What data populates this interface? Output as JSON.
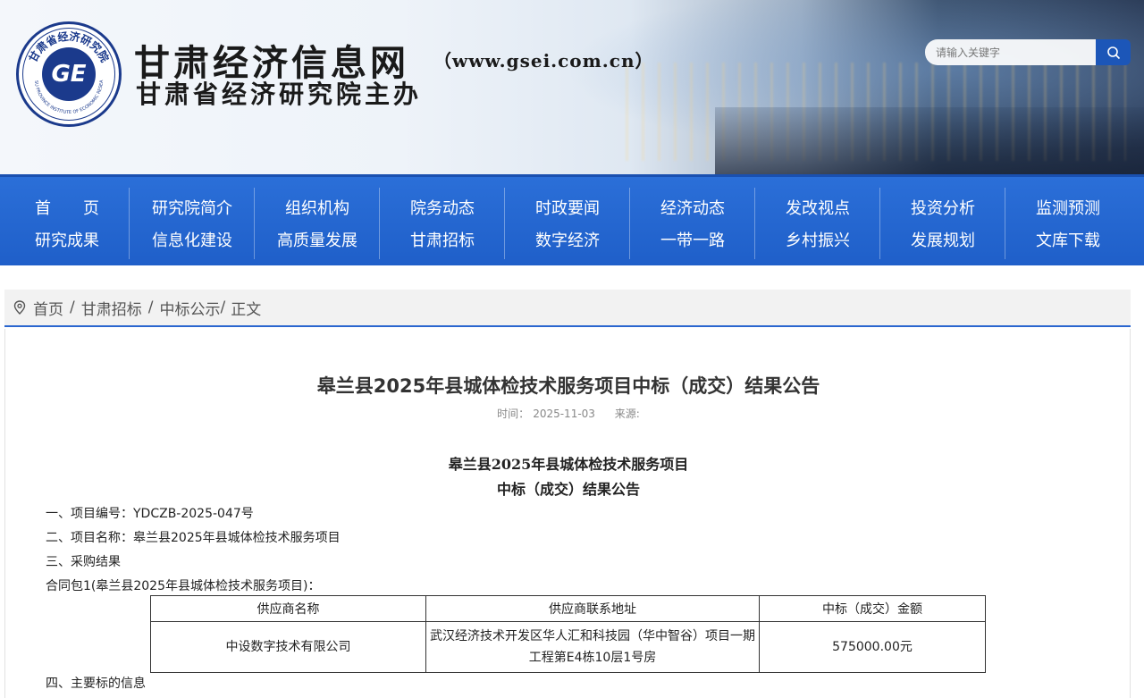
{
  "header": {
    "logo_text": "甘肃省经济研究院",
    "logo_subtext": "GANSU PROVINCE INSTITUTE OF ECONOMIC RESEARCH",
    "site_title": "甘肃经济信息网",
    "site_url": "（www.gsei.com.cn）",
    "site_subtitle": "甘肃省经济研究院主办",
    "search_placeholder": "请输入关键字",
    "search_icon": "search-icon"
  },
  "nav": {
    "columns": [
      {
        "top": "首　　页",
        "bottom": "研究成果"
      },
      {
        "top": "研究院简介",
        "bottom": "信息化建设"
      },
      {
        "top": "组织机构",
        "bottom": "高质量发展"
      },
      {
        "top": "院务动态",
        "bottom": "甘肃招标"
      },
      {
        "top": "时政要闻",
        "bottom": "数字经济"
      },
      {
        "top": "经济动态",
        "bottom": "一带一路"
      },
      {
        "top": "发改视点",
        "bottom": "乡村振兴"
      },
      {
        "top": "投资分析",
        "bottom": "发展规划"
      },
      {
        "top": "监测预测",
        "bottom": "文库下载"
      }
    ]
  },
  "breadcrumb": {
    "icon": "location-pin-icon",
    "home": "首页",
    "sep": "/",
    "section": "甘肃招标",
    "subsection": "中标公示",
    "sep2": "/",
    "current": "正文"
  },
  "article": {
    "title": "皋兰县2025年县城体检技术服务项目中标（成交）结果公告",
    "time_label": "时间：",
    "time_value": "2025-11-03",
    "source_label": "来源:",
    "doc_title_line1": "皋兰县2025年县城体检技术服务项目",
    "doc_title_line2": "中标（成交）结果公告",
    "lines": [
      "一、项目编号：YDCZB-2025-047号",
      "二、项目名称：皋兰县2025年县城体检技术服务项目",
      "三、采购结果",
      "合同包1(皋兰县2025年县城体检技术服务项目)：",
      "四、主要标的信息"
    ],
    "table": {
      "headers": [
        "供应商名称",
        "供应商联系地址",
        "中标（成交）金额"
      ],
      "rows": [
        [
          "中设数字技术有限公司",
          "武汉经济技术开发区华人汇和科技园（华中智谷）项目一期工程第E4栋10层1号房",
          "575000.00元"
        ]
      ]
    }
  },
  "colors": {
    "nav_blue": "#1f5fc9",
    "accent": "#2a66cf",
    "search_button": "#1c56b8"
  }
}
